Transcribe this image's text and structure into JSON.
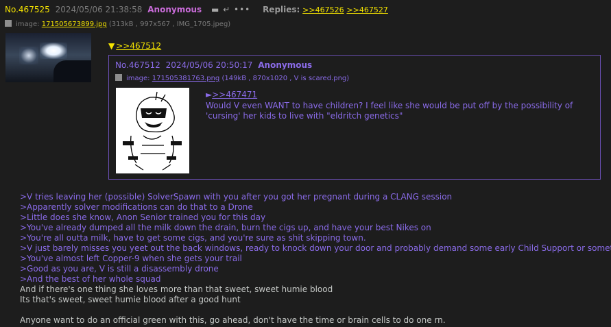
{
  "post": {
    "number": "No.467525",
    "date": "2024/05/06 21:38:58",
    "name": "Anonymous",
    "icons": "▬ ↵ •••",
    "replies_label": "Replies:",
    "replies": [
      ">>467526",
      ">>467527"
    ],
    "file": {
      "label": "image:",
      "filename": "171505673899.jpg",
      "meta": "(313kB , 997x567 , IMG_1705.jpeg)"
    }
  },
  "quote_link": {
    "arrow": "▼",
    "text": ">>467512"
  },
  "quoted": {
    "number": "No.467512",
    "date": "2024/05/06 20:50:17",
    "name": "Anonymous",
    "file": {
      "label": "image:",
      "filename": "171505381763.png",
      "meta": "(149kB , 870x1020 , V is scared.png)"
    },
    "ref": {
      "arrow": "►",
      "text": ">>467471"
    },
    "text": "Would V even WANT to have children? I feel like she would be put off by the possibility of 'cursing' her kids to live with \"eldritch genetics\""
  },
  "body_lines": [
    {
      "kind": "gt",
      "text": ">V tries leaving her (possible) SolverSpawn with you after you got her pregnant during a CLANG session"
    },
    {
      "kind": "gt",
      "text": ">Apparently solver modifications can do that to a Drone"
    },
    {
      "kind": "gt",
      "text": ">Little does she know, Anon Senior trained you for this day"
    },
    {
      "kind": "gt",
      "text": ">You've already dumped all the milk down the drain, burn the cigs up, and have your best Nikes on"
    },
    {
      "kind": "gt",
      "text": ">You're all outta milk, have to get some cigs, and you're sure as shit skipping town."
    },
    {
      "kind": "gt",
      "text": ">V just barely misses you yeet out the back windows, ready to knock down your door and probably demand some early Child Support or something."
    },
    {
      "kind": "gt",
      "text": ">You've almost left Copper-9 when she gets your trail"
    },
    {
      "kind": "gt",
      "text": ">Good as you are, V is still a disassembly drone"
    },
    {
      "kind": "gt",
      "text": ">And the best of her whole squad"
    },
    {
      "kind": "pl",
      "text": "And if there's one thing she loves more than that sweet, sweet humie blood"
    },
    {
      "kind": "pl",
      "text": "Its that's sweet, sweet humie blood after a good hunt"
    },
    {
      "kind": "blank",
      "text": ""
    },
    {
      "kind": "pl",
      "text": "Anyone want to do an official green with this, go ahead, don't have the time or brain cells to do one rn."
    }
  ]
}
